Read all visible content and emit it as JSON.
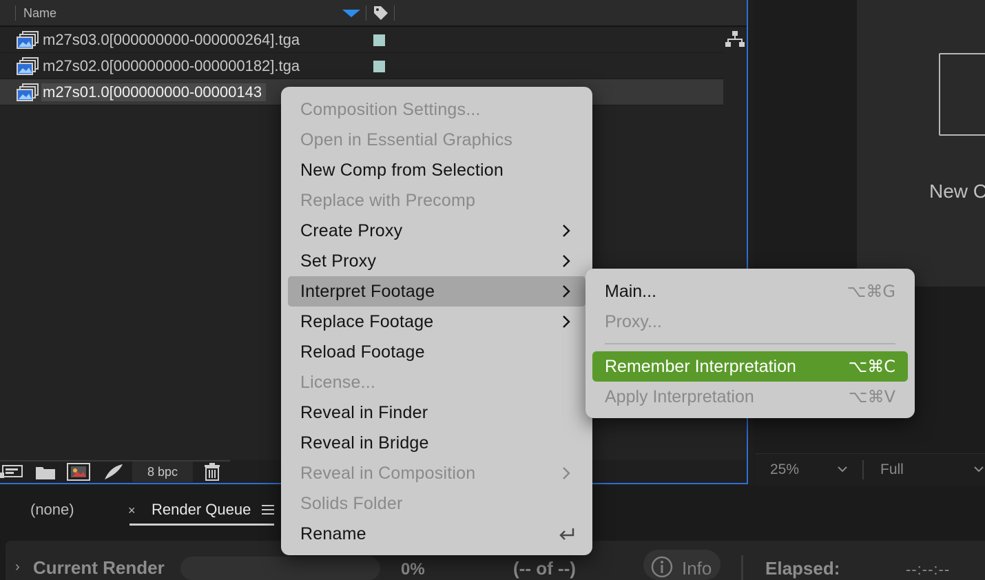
{
  "project_panel": {
    "column_name": "Name",
    "files": [
      {
        "name": "m27s03.0[000000000-000000264].tga",
        "selected": false
      },
      {
        "name": "m27s02.0[000000000-000000182].tga",
        "selected": false
      },
      {
        "name": "m27s01.0[000000000-00000143",
        "selected": true
      }
    ],
    "bpc": "8 bpc"
  },
  "viewer": {
    "new_comp_text": "New C",
    "zoom": "25%",
    "resolution": "Full"
  },
  "render_queue": {
    "tab_none": "(none)",
    "tab_close": "×",
    "tab_label": "Render Queue",
    "current_render": "Current Render",
    "percent": "0%",
    "of_text": "(-- of --)",
    "info": "Info",
    "elapsed_label": "Elapsed:",
    "elapsed_value": "--:--:--"
  },
  "context_menu": {
    "items": [
      {
        "label": "Composition Settings...",
        "disabled": true,
        "submenu": false
      },
      {
        "label": "Open in Essential Graphics",
        "disabled": true,
        "submenu": false
      },
      {
        "label": "New Comp from Selection",
        "disabled": false,
        "submenu": false
      },
      {
        "label": "Replace with Precomp",
        "disabled": true,
        "submenu": false
      },
      {
        "label": "Create Proxy",
        "disabled": false,
        "submenu": true
      },
      {
        "label": "Set Proxy",
        "disabled": false,
        "submenu": true
      },
      {
        "label": "Interpret Footage",
        "disabled": false,
        "submenu": true,
        "highlighted": true
      },
      {
        "label": "Replace Footage",
        "disabled": false,
        "submenu": true
      },
      {
        "label": "Reload Footage",
        "disabled": false,
        "submenu": false
      },
      {
        "label": "License...",
        "disabled": true,
        "submenu": false
      },
      {
        "label": "Reveal in Finder",
        "disabled": false,
        "submenu": false
      },
      {
        "label": "Reveal in Bridge",
        "disabled": false,
        "submenu": false
      },
      {
        "label": "Reveal in Composition",
        "disabled": true,
        "submenu": true
      },
      {
        "label": "Solids Folder",
        "disabled": true,
        "submenu": false
      },
      {
        "label": "Rename",
        "disabled": false,
        "submenu": false
      }
    ]
  },
  "submenu": {
    "items": [
      {
        "label": "Main...",
        "shortcut": "⌥⌘G",
        "disabled": false
      },
      {
        "label": "Proxy...",
        "shortcut": "",
        "disabled": true
      },
      {
        "label": "Remember Interpretation",
        "shortcut": "⌥⌘C",
        "disabled": false,
        "active": true
      },
      {
        "label": "Apply Interpretation",
        "shortcut": "⌥⌘V",
        "disabled": true
      }
    ]
  },
  "colors": {
    "accent_blue": "#2d6fd6",
    "highlight_green": "#5a9a2a",
    "label_swatch": "#a8cfc9",
    "menu_bg": "#cbcbcb"
  }
}
